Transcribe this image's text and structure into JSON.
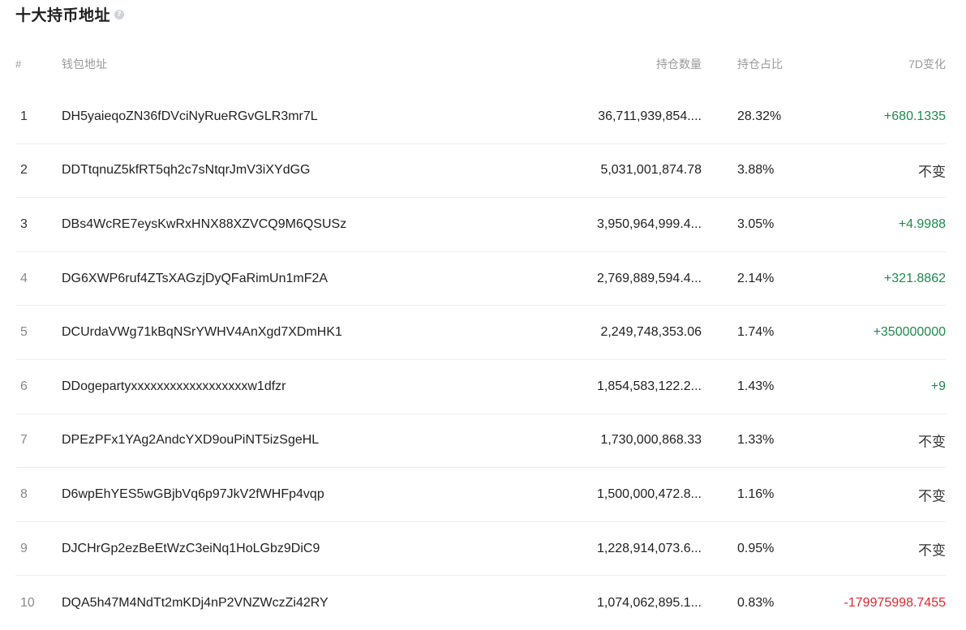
{
  "header": {
    "title": "十大持币地址",
    "info_glyph": "?"
  },
  "table": {
    "columns": {
      "rank": "#",
      "address": "钱包地址",
      "quantity": "持仓数量",
      "percent": "持仓占比",
      "change": "7D变化"
    },
    "rows": [
      {
        "rank": "1",
        "address": "DH5yaieqoZN36fDVciNyRueRGvGLR3mr7L",
        "quantity": "36,711,939,854....",
        "percent": "28.32%",
        "change": "+680.1335",
        "trend": "pos"
      },
      {
        "rank": "2",
        "address": "DDTtqnuZ5kfRT5qh2c7sNtqrJmV3iXYdGG",
        "quantity": "5,031,001,874.78",
        "percent": "3.88%",
        "change": "不变",
        "trend": "same"
      },
      {
        "rank": "3",
        "address": "DBs4WcRE7eysKwRxHNX88XZVCQ9M6QSUSz",
        "quantity": "3,950,964,999.4...",
        "percent": "3.05%",
        "change": "+4.9988",
        "trend": "pos"
      },
      {
        "rank": "4",
        "address": "DG6XWP6ruf4ZTsXAGzjDyQFaRimUn1mF2A",
        "quantity": "2,769,889,594.4...",
        "percent": "2.14%",
        "change": "+321.8862",
        "trend": "pos"
      },
      {
        "rank": "5",
        "address": "DCUrdaVWg71kBqNSrYWHV4AnXgd7XDmHK1",
        "quantity": "2,249,748,353.06",
        "percent": "1.74%",
        "change": "+350000000",
        "trend": "pos"
      },
      {
        "rank": "6",
        "address": "DDogepartyxxxxxxxxxxxxxxxxxxw1dfzr",
        "quantity": "1,854,583,122.2...",
        "percent": "1.43%",
        "change": "+9",
        "trend": "pos"
      },
      {
        "rank": "7",
        "address": "DPEzPFx1YAg2AndcYXD9ouPiNT5izSgeHL",
        "quantity": "1,730,000,868.33",
        "percent": "1.33%",
        "change": "不变",
        "trend": "same"
      },
      {
        "rank": "8",
        "address": "D6wpEhYES5wGBjbVq6p97JkV2fWHFp4vqp",
        "quantity": "1,500,000,472.8...",
        "percent": "1.16%",
        "change": "不变",
        "trend": "same"
      },
      {
        "rank": "9",
        "address": "DJCHrGp2ezBeEtWzC3eiNq1HoLGbz9DiC9",
        "quantity": "1,228,914,073.6...",
        "percent": "0.95%",
        "change": "不变",
        "trend": "same"
      },
      {
        "rank": "10",
        "address": "DQA5h47M4NdTt2mKDj4nP2VNZWczZi42RY",
        "quantity": "1,074,062,895.1...",
        "percent": "0.83%",
        "change": "-179975998.7455",
        "trend": "neg"
      }
    ]
  },
  "colors": {
    "positive": "#1e8a4c",
    "negative": "#e0262f",
    "header_text": "#9a9a9a",
    "divider": "#eeeeee"
  }
}
